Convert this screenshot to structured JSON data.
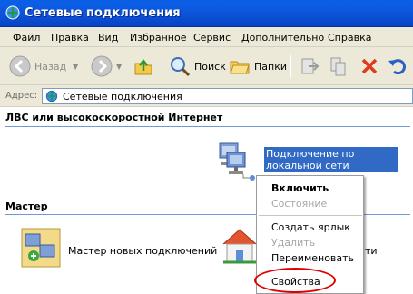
{
  "window": {
    "title": "Сетевые подключения",
    "icon": "network-connections-icon"
  },
  "menubar": {
    "items": [
      "Файл",
      "Правка",
      "Вид",
      "Избранное",
      "Сервис",
      "Дополнительно",
      "Справка"
    ]
  },
  "toolbar": {
    "back_label": "Назад",
    "search_label": "Поиск",
    "folders_label": "Папки"
  },
  "address": {
    "label": "Адрес:",
    "value": "Сетевые подключения"
  },
  "groups": {
    "lan_header": "ЛВС или высокоскоростной Интернет",
    "wizard_header": "Мастер"
  },
  "items": {
    "lan_connection": "Подключение по локальной сети",
    "new_connection_wizard": "Мастер новых подключений",
    "home_network_partial": "ти"
  },
  "context_menu": {
    "enable": "Включить",
    "status": "Состояние",
    "create_shortcut": "Создать ярлык",
    "delete": "Удалить",
    "rename": "Переименовать",
    "properties": "Свойства"
  },
  "colors": {
    "title_bar": "#0b5fe6",
    "selection": "#316ac5",
    "highlight_ellipse": "#e00000"
  }
}
